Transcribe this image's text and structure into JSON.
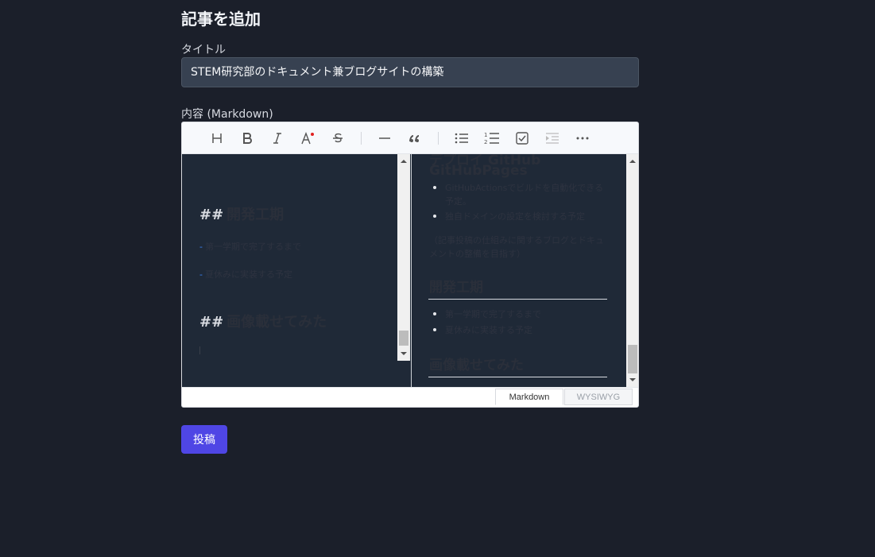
{
  "page": {
    "title": "記事を追加"
  },
  "form": {
    "title_label": "タイトル",
    "title_value": "STEM研究部のドキュメント兼ブログサイトの構築",
    "content_label": "内容 (Markdown)",
    "submit_label": "投稿"
  },
  "toolbar": {
    "buttons": [
      "heading-icon",
      "bold-icon",
      "italic-icon",
      "text-color-icon",
      "strikethrough-icon",
      "horizontal-rule-icon",
      "quote-icon",
      "bullet-list-icon",
      "ordered-list-icon",
      "task-list-icon",
      "indent-icon",
      "more-icon"
    ]
  },
  "editor": {
    "markdown": {
      "heading_marker": "##",
      "heading1": "開発工期",
      "list_marker": "-",
      "item1": "第一学期で完了するまで",
      "item2": "夏休みに実装する予定",
      "heading2": "画像載せてみた"
    },
    "preview": {
      "top_heading_line1": "デプロイ GitHub",
      "top_heading_line2": "GitHubPages",
      "bullet1": "GitHubActionsでビルドを自動化できる予定。",
      "bullet2": "独自ドメインの設定を検討する予定",
      "paragraph": "（記事投稿の仕組みに関するブログとドキュメントの整備を目指す）",
      "heading1": "開発工期",
      "item1": "第一学期で完了するまで",
      "item2": "夏休みに実装する予定",
      "heading2": "画像載せてみた"
    },
    "mode_tabs": {
      "markdown": "Markdown",
      "wysiwyg": "WYSIWYG"
    }
  }
}
